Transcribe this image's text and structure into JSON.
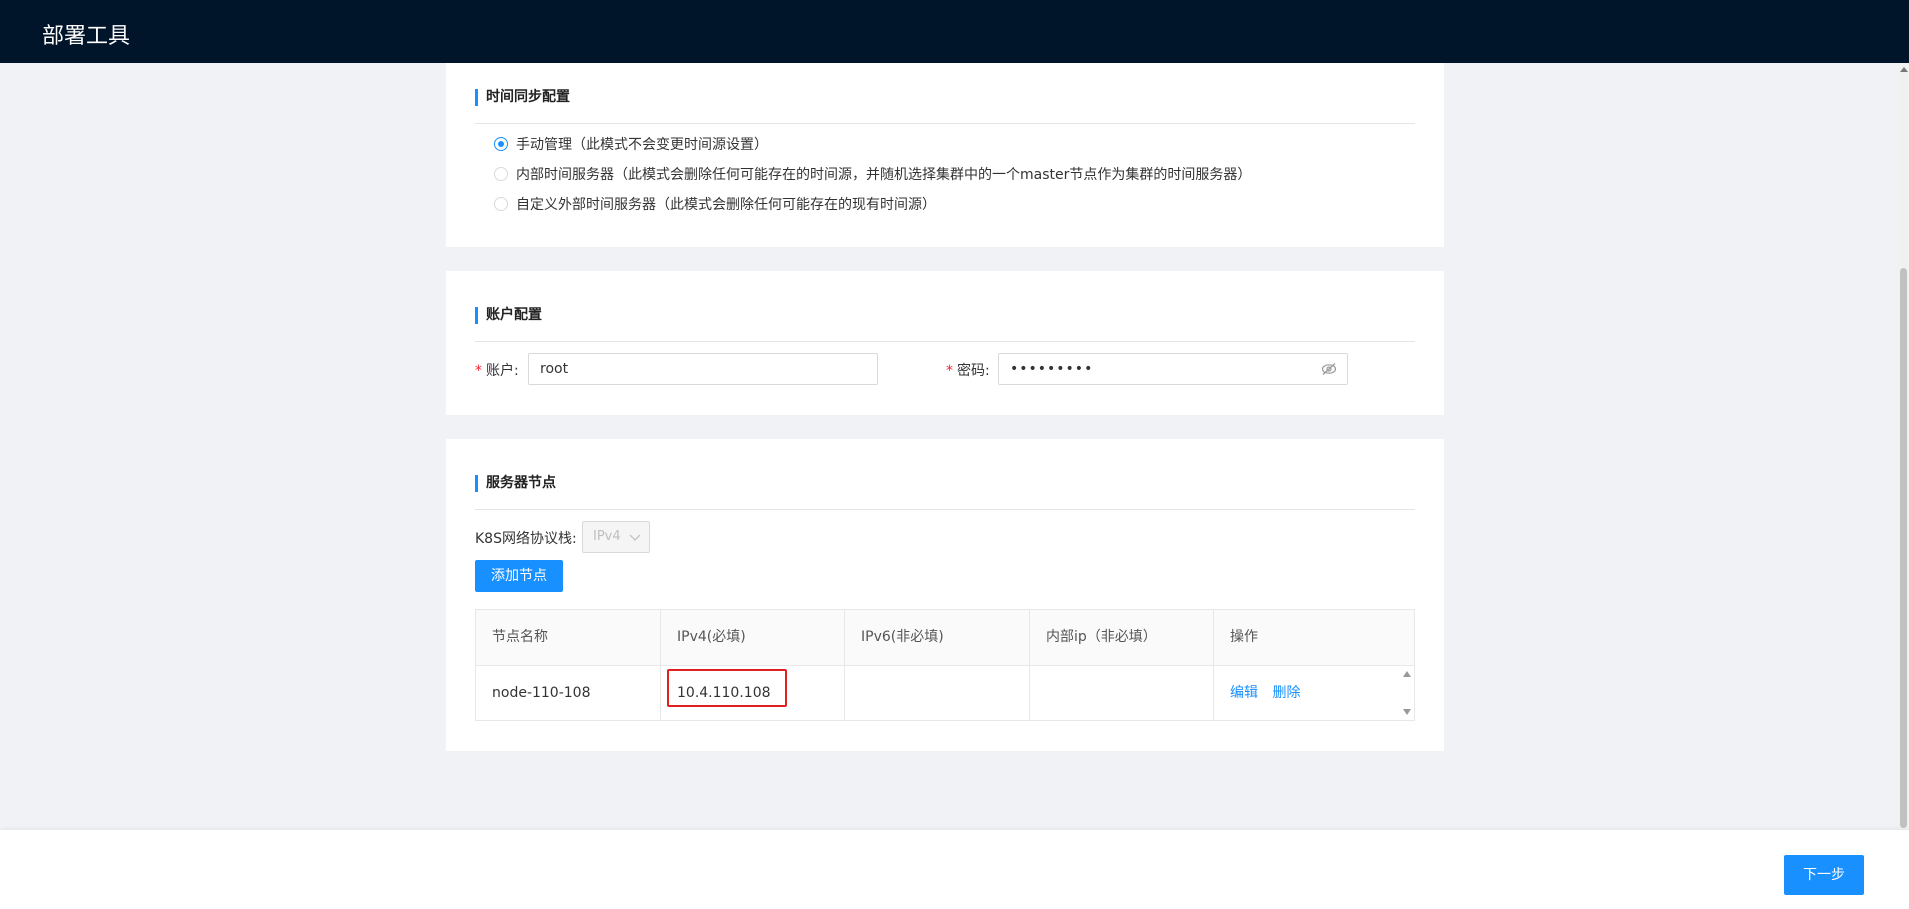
{
  "app": {
    "title": "部署工具"
  },
  "time_sync": {
    "title": "时间同步配置",
    "options": [
      {
        "label": "手动管理（此模式不会变更时间源设置）",
        "checked": true
      },
      {
        "label": "内部时间服务器（此模式会删除任何可能存在的时间源，并随机选择集群中的一个master节点作为集群的时间服务器）",
        "checked": false
      },
      {
        "label": "自定义外部时间服务器（此模式会删除任何可能存在的现有时间源）",
        "checked": false
      }
    ]
  },
  "account": {
    "title": "账户配置",
    "required_mark": "*",
    "user_label": "账户:",
    "user_value": "root",
    "password_label": "密码:",
    "password_value": "•••••••••"
  },
  "nodes": {
    "title": "服务器节点",
    "stack_label": "K8S网络协议栈:",
    "stack_value": "IPv4",
    "add_button": "添加节点",
    "columns": [
      "节点名称",
      "IPv4(必填)",
      "IPv6(非必填)",
      "内部ip（非必填）",
      "操作"
    ],
    "rows": [
      {
        "name": "node-110-108",
        "ipv4": "10.4.110.108",
        "ipv6": "",
        "internal_ip": "",
        "edit": "编辑",
        "delete": "删除"
      }
    ]
  },
  "footer": {
    "next_button": "下一步"
  }
}
